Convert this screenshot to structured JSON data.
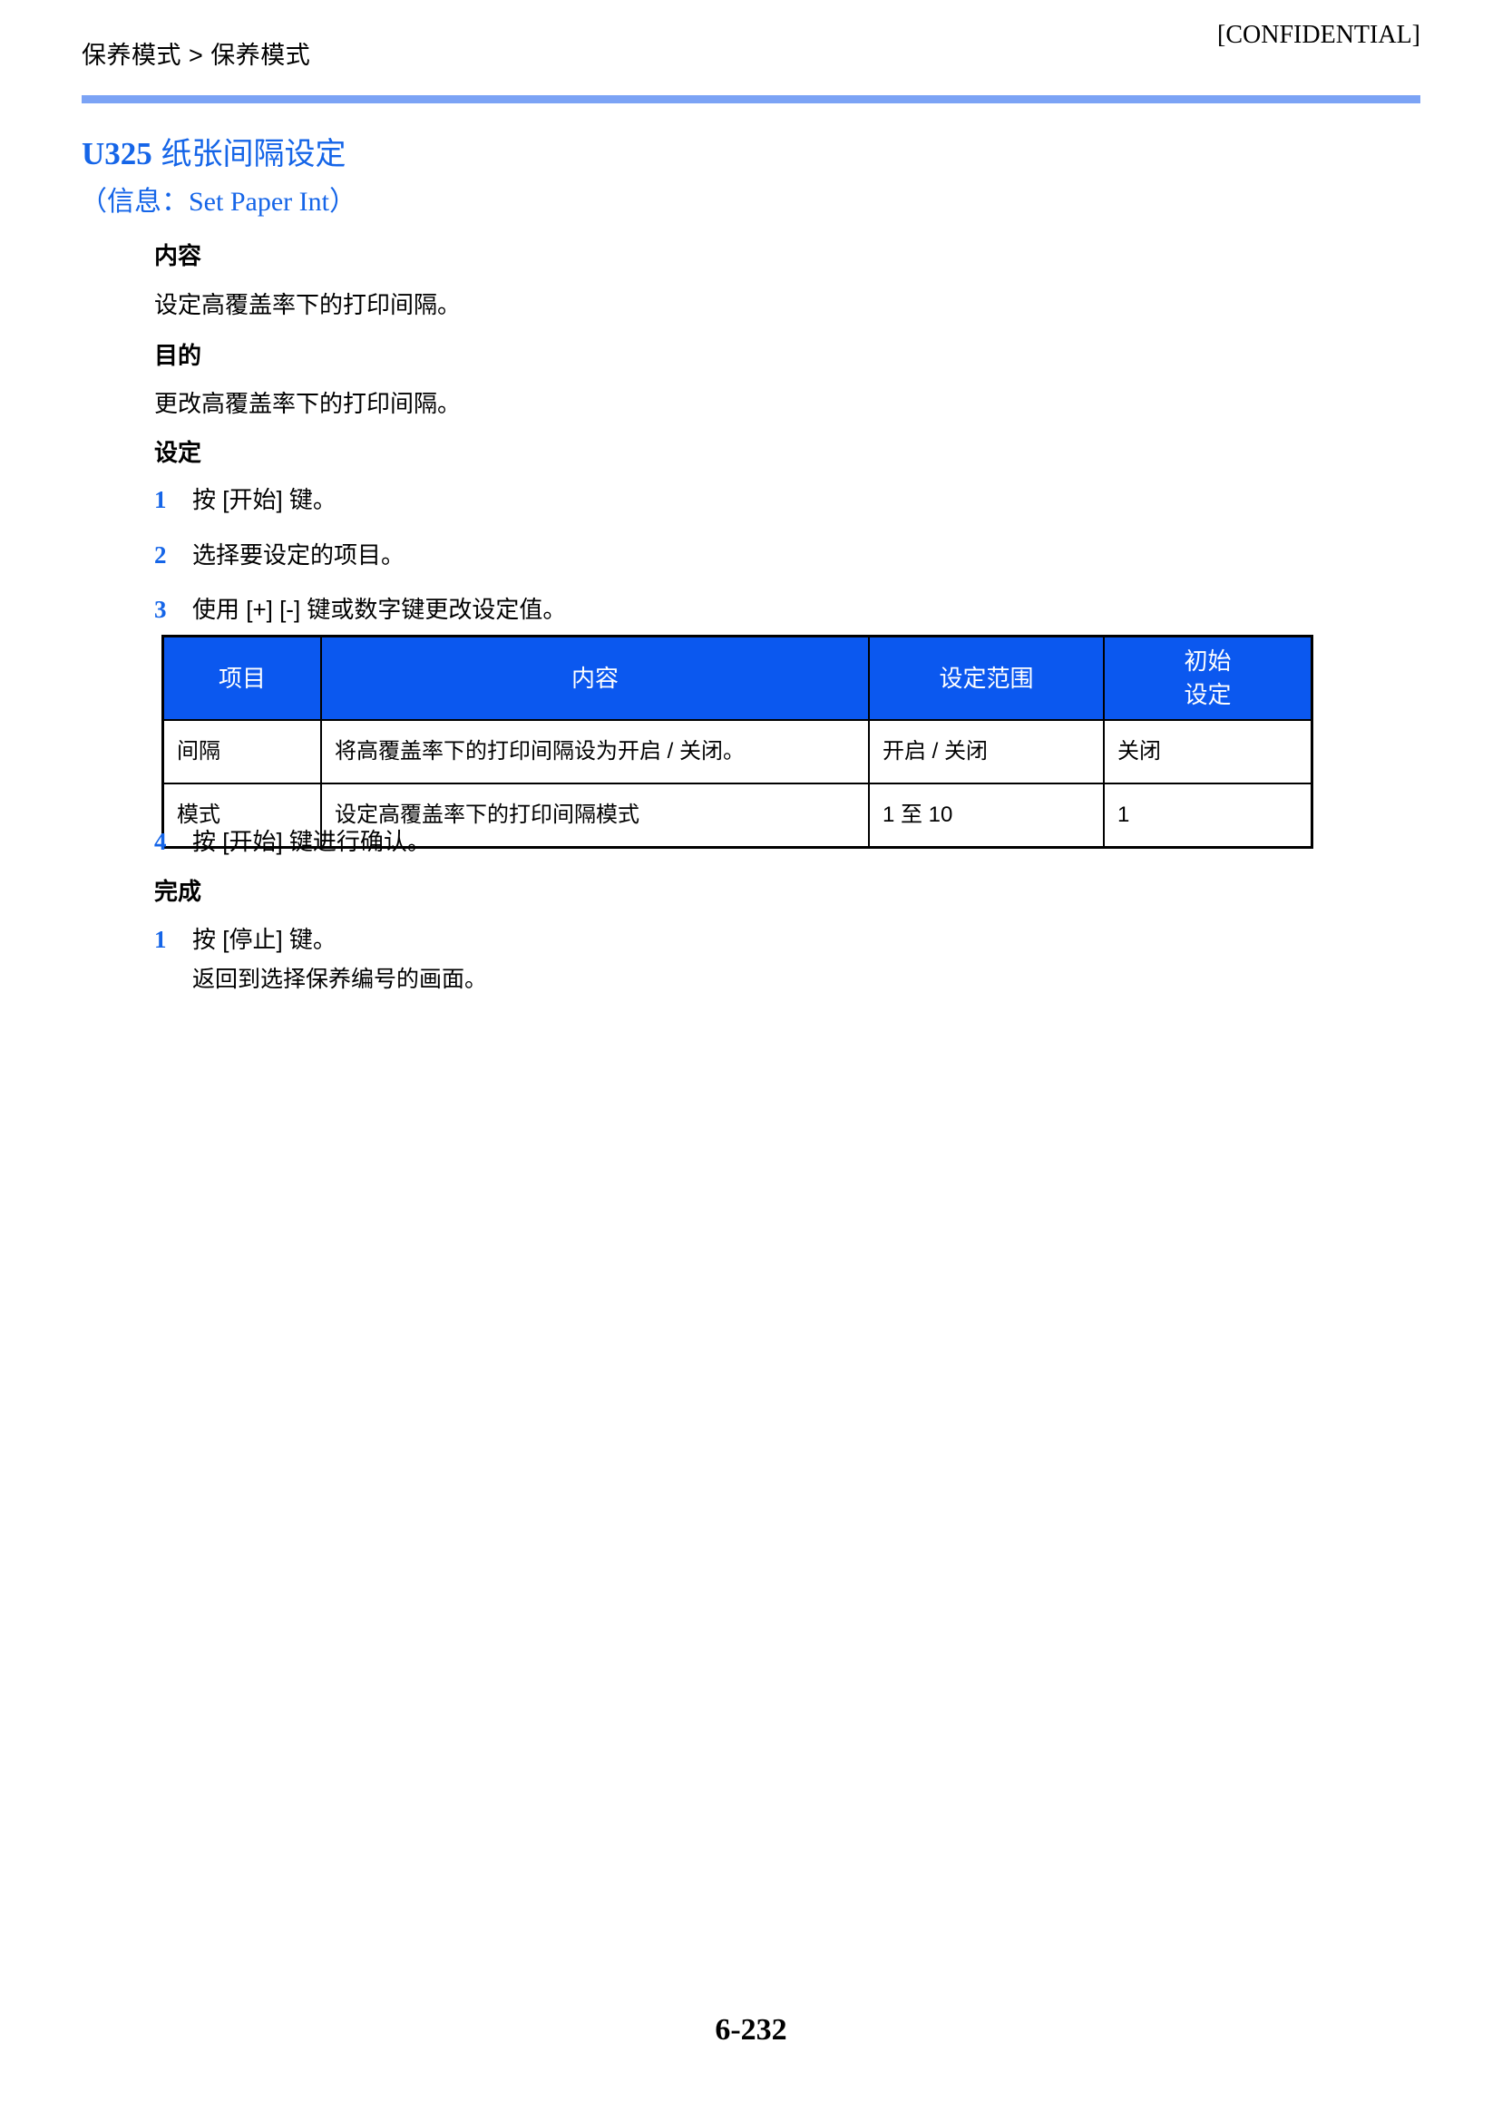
{
  "header": {
    "breadcrumb": "保养模式 > 保养模式",
    "confidential": "[CONFIDENTIAL]",
    "rule_color": "#7BA3F5"
  },
  "section": {
    "code": "U325",
    "title_cn": "纸张间隔设定",
    "subtitle": "（信息：Set Paper Int）",
    "subtitle_cn": "（信息：",
    "subtitle_en": "Set Paper Int",
    "subtitle_close": "）",
    "accent_color": "#1565E8"
  },
  "blocks": {
    "content_heading": "内容",
    "content_text": "设定高覆盖率下的打印间隔。",
    "purpose_heading": "目的",
    "purpose_text": "更改高覆盖率下的打印间隔。",
    "setting_heading": "设定",
    "complete_heading": "完成"
  },
  "setting_steps": [
    {
      "num": "1",
      "text": "按 [开始] 键。"
    },
    {
      "num": "2",
      "text": "选择要设定的项目。"
    },
    {
      "num": "3",
      "text": "使用 [+] [-] 键或数字键更改设定值。"
    },
    {
      "num": "4",
      "text": "按 [开始] 键进行确认。"
    }
  ],
  "complete_steps": [
    {
      "num": "1",
      "text": "按 [停止] 键。",
      "sub": "返回到选择保养编号的画面。"
    }
  ],
  "table": {
    "header_bg": "#0B58EF",
    "columns": [
      "项目",
      "内容",
      "设定范围",
      "初始\n设定"
    ],
    "col_item": "项目",
    "col_content": "内容",
    "col_range": "设定范围",
    "col_default_line1": "初始",
    "col_default_line2": "设定",
    "rows": [
      {
        "item": "间隔",
        "content": "将高覆盖率下的打印间隔设为开启 / 关闭。",
        "range": "开启 / 关闭",
        "default": "关闭"
      },
      {
        "item": "模式",
        "content": "设定高覆盖率下的打印间隔模式",
        "range": "1 至 10",
        "default": "1"
      }
    ]
  },
  "footer": {
    "page_number": "6-232"
  }
}
